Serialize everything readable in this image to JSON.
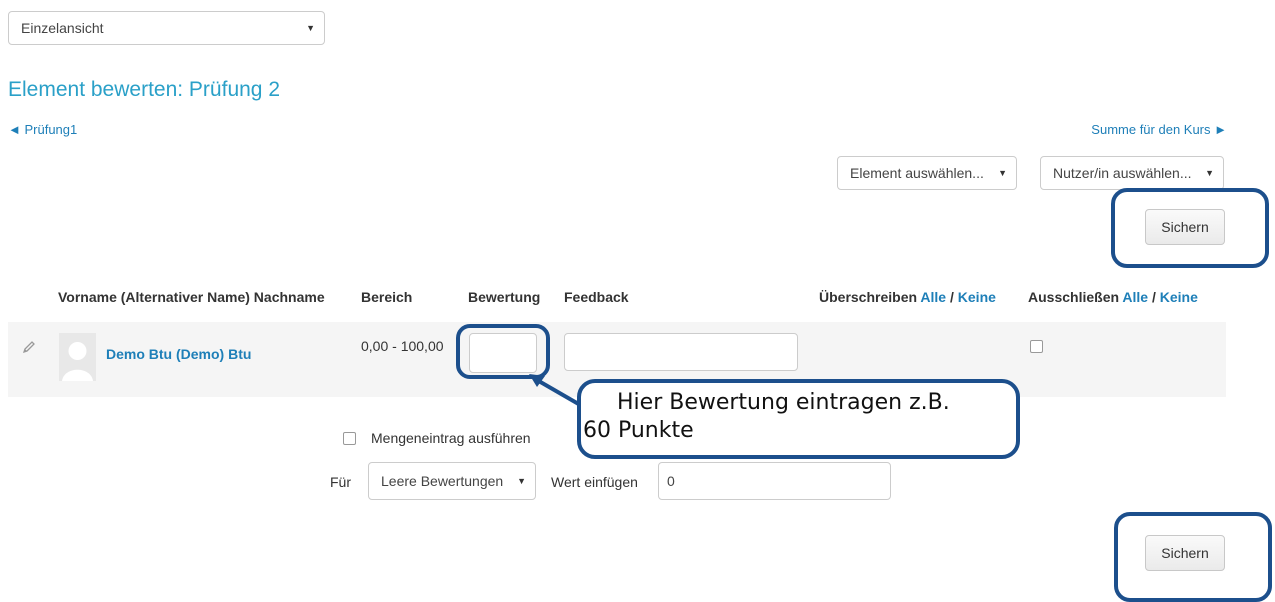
{
  "view_select": {
    "value": "Einzelansicht"
  },
  "page_title": "Element bewerten: Prüfung 2",
  "nav": {
    "prev_label": "◄ Prüfung1",
    "next_label": "Summe für den Kurs ►"
  },
  "selectors": {
    "element": "Element auswählen...",
    "user": "Nutzer/in auswählen..."
  },
  "save_label": "Sichern",
  "table": {
    "headers": {
      "name": "Vorname (Alternativer Name) Nachname",
      "range": "Bereich",
      "grade": "Bewertung",
      "feedback": "Feedback",
      "override": "Überschreiben",
      "exclude": "Ausschließen",
      "all": "Alle",
      "sep": "/",
      "none": "Keine"
    },
    "rows": [
      {
        "name": "Demo Btu (Demo) Btu",
        "range": "0,00 - 100,00",
        "grade": "",
        "feedback": "",
        "excluded": false
      }
    ]
  },
  "bulk": {
    "toggle_label": "Mengeneintrag ausführen",
    "for_label": "Für",
    "for_select": "Leere Bewertungen",
    "insert_label": "Wert einfügen",
    "insert_value": "0"
  },
  "annotation": {
    "line1": "Hier Bewertung eintragen z.B.",
    "line2": "60 Punkte"
  },
  "colors": {
    "title": "#2aa0c8",
    "link": "#1e7fb8",
    "annotation": "#1c4f8c",
    "row_bg": "#f5f5f5"
  }
}
